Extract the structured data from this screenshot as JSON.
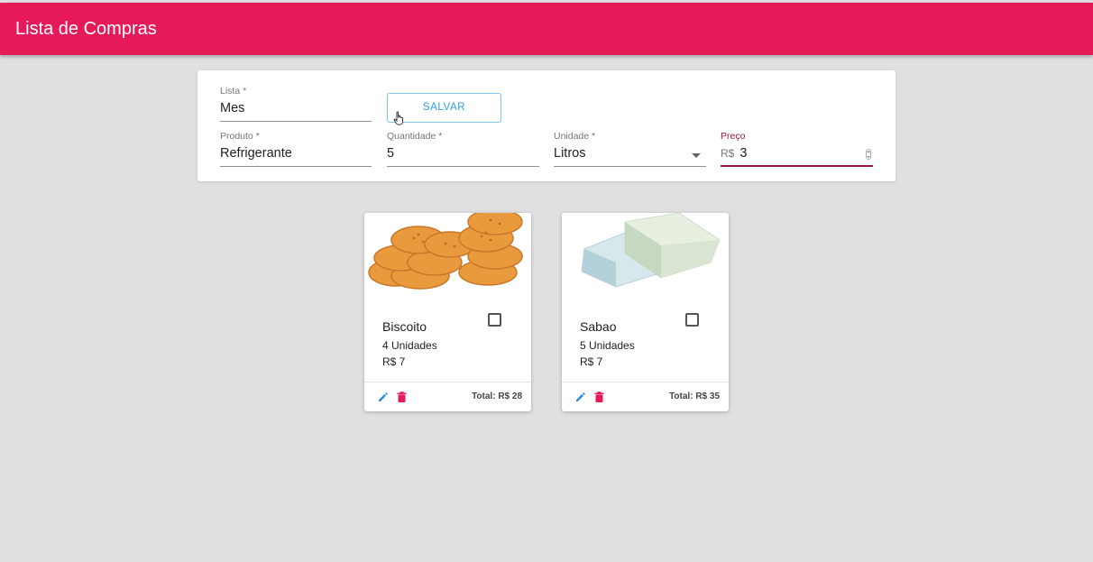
{
  "app": {
    "title": "Lista de Compras"
  },
  "form": {
    "lista": {
      "label": "Lista *",
      "value": "Mes"
    },
    "save_label": "SALVAR",
    "produto": {
      "label": "Produto *",
      "value": "Refrigerante"
    },
    "quantidade": {
      "label": "Quantidade *",
      "value": "5"
    },
    "unidade": {
      "label": "Unidade *",
      "value": "Litros"
    },
    "preco": {
      "label": "Preço",
      "prefix": "R$",
      "value": "3"
    }
  },
  "items": [
    {
      "name": "Biscoito",
      "quantity": "4 Unidades",
      "price": "R$ 7",
      "total": "Total: R$ 28",
      "image": "crackers-image"
    },
    {
      "name": "Sabao",
      "quantity": "5 Unidades",
      "price": "R$ 7",
      "total": "Total: R$ 35",
      "image": "soap-image"
    }
  ],
  "colors": {
    "appbar": "#e61a58",
    "accent_blue": "#2aa0dc",
    "focus": "#9c1742",
    "delete": "#e61a58"
  }
}
